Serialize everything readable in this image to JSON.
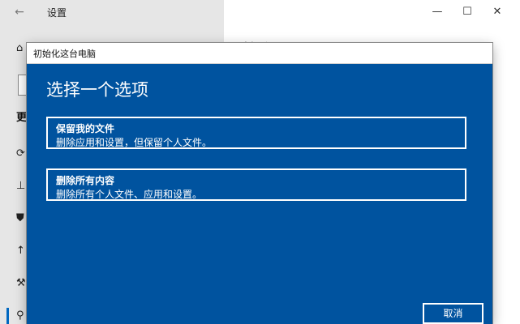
{
  "settings_window": {
    "title": "设置",
    "back_icon": "←",
    "minimize_icon": "—",
    "maximize_icon": "☐",
    "close_icon": "✕",
    "sidebar": {
      "home_icon": "⌂",
      "section_heading_partial": "更",
      "items": [
        {
          "icon_name": "sync-icon",
          "glyph": "⟳"
        },
        {
          "icon_name": "delivery-icon",
          "glyph": "⊥"
        },
        {
          "icon_name": "shield-icon",
          "glyph": "⛊"
        },
        {
          "icon_name": "backup-icon",
          "glyph": "↑"
        },
        {
          "icon_name": "wrench-icon",
          "glyph": "⚒"
        },
        {
          "icon_name": "recovery-icon",
          "glyph": "⚲"
        }
      ]
    },
    "content_heading_partial": "恢复"
  },
  "dialog": {
    "title": "初始化这台电脑",
    "heading": "选择一个选项",
    "options": [
      {
        "title": "保留我的文件",
        "description": "删除应用和设置，但保留个人文件。"
      },
      {
        "title": "删除所有内容",
        "description": "删除所有个人文件、应用和设置。"
      }
    ],
    "cancel_label": "取消",
    "background_color": "#00539f"
  }
}
